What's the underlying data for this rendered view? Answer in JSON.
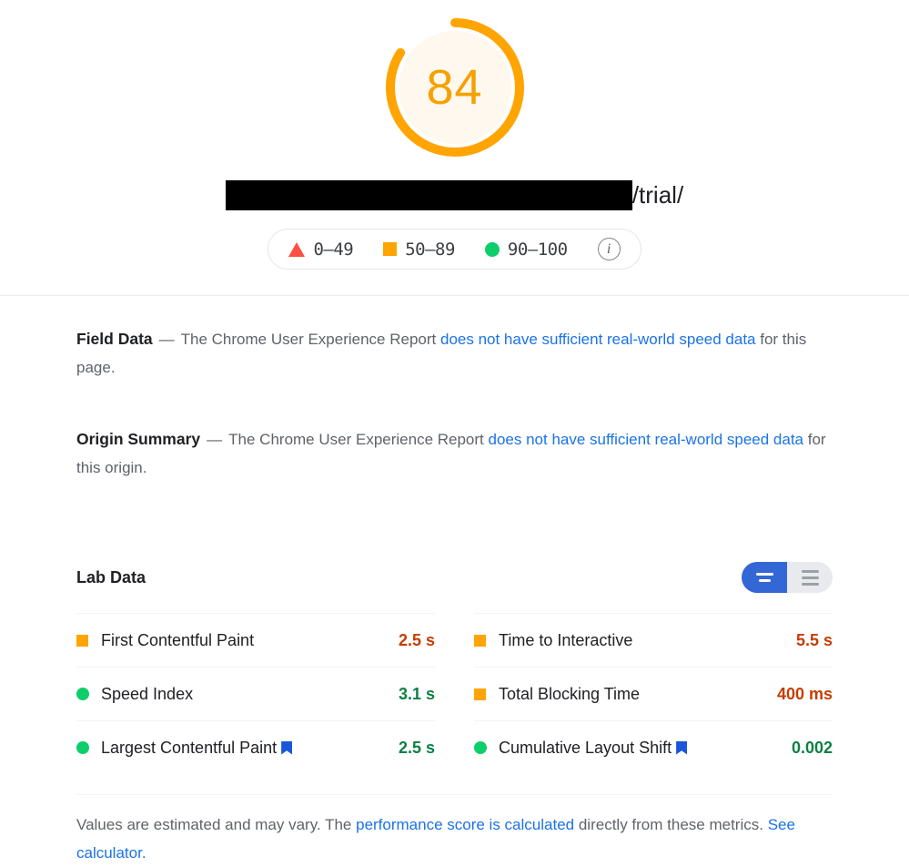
{
  "gauge": {
    "score": "84",
    "score_percent": 84,
    "color": "#FFA400",
    "track_color": "#FFF8EF",
    "score_text_color": "#F5A100"
  },
  "url": {
    "redacted_label": "",
    "visible_path": "/trial/"
  },
  "legend": {
    "items": [
      {
        "marker": "triangle-icon",
        "label": "0–49",
        "color": "#FF4E42"
      },
      {
        "marker": "square-icon",
        "label": "50–89",
        "color": "#FFA400"
      },
      {
        "marker": "circle-icon",
        "label": "90–100",
        "color": "#0CCE6B"
      }
    ],
    "info_icon": "info-icon",
    "info_glyph": "i"
  },
  "field_data": {
    "title": "Field Data",
    "dash": "—",
    "text_before": "The Chrome User Experience Report ",
    "link_text": "does not have sufficient real-world speed data",
    "text_after": " for this page."
  },
  "origin_summary": {
    "title": "Origin Summary",
    "dash": "—",
    "text_before": "The Chrome User Experience Report ",
    "link_text": "does not have sufficient real-world speed data",
    "text_after": " for this origin."
  },
  "lab_data": {
    "title": "Lab Data",
    "toggle": {
      "active_view": "condensed-view",
      "inactive_view": "expanded-view",
      "active_color": "#3367d6",
      "inactive_color": "#e8eaed"
    },
    "left_column": [
      {
        "status": "square-icon",
        "status_color": "#FFA400",
        "name": "First Contentful Paint",
        "core_web_vital": false,
        "value": "2.5 s",
        "value_color": "#C63D00"
      },
      {
        "status": "circle-icon",
        "status_color": "#0CCE6B",
        "name": "Speed Index",
        "core_web_vital": false,
        "value": "3.1 s",
        "value_color": "#0C8043"
      },
      {
        "status": "circle-icon",
        "status_color": "#0CCE6B",
        "name": "Largest Contentful Paint",
        "core_web_vital": true,
        "value": "2.5 s",
        "value_color": "#0C8043"
      }
    ],
    "right_column": [
      {
        "status": "square-icon",
        "status_color": "#FFA400",
        "name": "Time to Interactive",
        "core_web_vital": false,
        "value": "5.5 s",
        "value_color": "#C63D00"
      },
      {
        "status": "square-icon",
        "status_color": "#FFA400",
        "name": "Total Blocking Time",
        "core_web_vital": false,
        "value": "400 ms",
        "value_color": "#C63D00"
      },
      {
        "status": "circle-icon",
        "status_color": "#0CCE6B",
        "name": "Cumulative Layout Shift",
        "core_web_vital": true,
        "value": "0.002",
        "value_color": "#0C8043"
      }
    ]
  },
  "footnote": {
    "text_1": "Values are estimated and may vary. The ",
    "link_1": "performance score is calculated",
    "text_2": " directly from these metrics. ",
    "link_2": "See calculator."
  }
}
